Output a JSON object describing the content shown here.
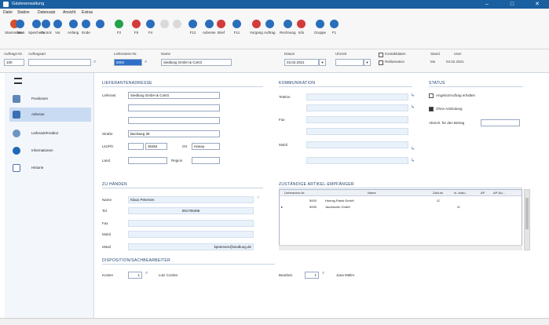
{
  "window": {
    "title": "Gästeverwaltung",
    "controls": [
      "–",
      "□",
      "✕"
    ]
  },
  "menu": [
    "Datei",
    "Station",
    "Datensatz",
    "Ansicht",
    "Extras"
  ],
  "toolbar": {
    "buttons": [
      {
        "label": "Stammdaten",
        "color": "#d84f2a"
      },
      {
        "label": "Neu",
        "color": "#2a6ebb"
      },
      {
        "label": "Speichern",
        "color": "#2a6ebb"
      },
      {
        "label": "Zurück",
        "color": "#2a6ebb"
      },
      {
        "label": "Vor",
        "color": "#2a6ebb"
      },
      {
        "label": "Anfang",
        "color": "#2a6ebb"
      },
      {
        "label": "Ende",
        "color": "#2a6ebb"
      },
      {
        "label": "",
        "color": "#2a6ebb"
      },
      {
        "label": "F2",
        "color": "#22a34a"
      },
      {
        "label": "F5",
        "color": "#d33b3b"
      },
      {
        "label": "F4",
        "color": "#2a6ebb"
      },
      {
        "label": "",
        "color": "#d9d9d9"
      },
      {
        "label": "",
        "color": "#d9d9d9"
      },
      {
        "label": "F12",
        "color": "#2a6ebb"
      },
      {
        "label": "Adresse",
        "color": "#2a6ebb"
      },
      {
        "label": "Brief",
        "color": "#d33b3b"
      },
      {
        "label": "F11",
        "color": "#2a6ebb"
      },
      {
        "label": "Vorgang",
        "color": "#d33b3b"
      },
      {
        "label": "Auftrag",
        "color": "#2a6ebb"
      },
      {
        "label": "Rechnung",
        "color": "#2a6ebb"
      },
      {
        "label": "Info",
        "color": "#d33b3b"
      },
      {
        "label": "Gruppe",
        "color": "#2a6ebb"
      },
      {
        "label": "F1",
        "color": "#2a6ebb"
      }
    ]
  },
  "filter": {
    "auftrag_label": "Auftrags-Nr.",
    "auftrag_value": "100",
    "auftragsart_label": "Auftragsart",
    "auftragsart_value": "",
    "lieferanten_label": "Lieferanten-Nr.",
    "lieferanten_value": "5000",
    "name_label": "Name",
    "name_value": "Siedlung GmbH & CoKG",
    "datum_label": "Datum",
    "datum_value": "03.02.2021",
    "uhrzeit_label": "Uhrzeit",
    "uhrzeit_value": "",
    "check1": "Kontaktdaten",
    "check2": "Reklamation",
    "stand_label": "Stand",
    "stand_value": "Mo",
    "user_label": "User",
    "datum2_value": "04.02.2021"
  },
  "sidebar": {
    "items": [
      {
        "label": "Positionen",
        "color": "#4a76ad"
      },
      {
        "label": "Adresse",
        "color": "#4a76ad"
      },
      {
        "label": "Lieferant/Kreditor",
        "color": "#4a76ad"
      },
      {
        "label": "Informationen",
        "color": "#2a6ebb"
      },
      {
        "label": "Historie",
        "color": "#4a76ad"
      }
    ]
  },
  "lieferantenadresse": {
    "heading": "LIEFERANTENADRESSE",
    "lieferant_label": "Lieferant",
    "lieferant_value": "Siedlung GmbH & CoKG",
    "line2": "",
    "line3": "",
    "strasse_label": "Straße",
    "strasse_value": "Backweg 38",
    "plz_label": "Lkz/Plz",
    "lkz_value": "",
    "plz_value": "36364",
    "ort_label": "Ort",
    "ort_value": "Hanau",
    "land_label": "Land",
    "land_value": "",
    "region_label": "Region",
    "region_value": ""
  },
  "kommunikation": {
    "heading": "KOMMUNIKATION",
    "telefon_label": "Telefon",
    "fax_label": "Fax",
    "mobil_label": "Mobil",
    "telefon": "",
    "fax": "",
    "mobil": ""
  },
  "status": {
    "heading": "STATUS",
    "angebot_label": "Angebot/Auftrag erhalten",
    "ohne_label": "Ohne Anbindung",
    "abrech_label": "Abrech. für den Betrag",
    "abrech_value": ""
  },
  "zu_haenden": {
    "heading": "ZU HÄNDEN",
    "name_label": "Name",
    "name_value": "Klaus Petersen",
    "tel_label": "Tel.",
    "tel_value": "091705496",
    "fax_label": "Fax",
    "fax_value": "",
    "mobil_label": "Mobil",
    "mobil_value": "",
    "email_label": "eMail",
    "email_value": "kpetersen@siedlung.de"
  },
  "zustaendige": {
    "heading": "ZUSTÄNDIGE ARTIKEL-EMPFÄNGER",
    "columns": [
      "Lieferanten-Nr.",
      "Name",
      "Zahl.ke",
      "in. Anbu.",
      "AP",
      "AP-Nu..."
    ],
    "rows": [
      {
        "nr": "5003",
        "name": "Hoenig Pabst GmbH",
        "z": "",
        "a": ""
      },
      {
        "nr": "5005",
        "name": "Jacobsohn GmbH",
        "z": "",
        "a": ""
      }
    ]
  },
  "disposition": {
    "heading": "DISPOSITION/SACHBEARBEITER",
    "kosten_label": "Kosten",
    "kosten_value": "1",
    "kosten_name": "Lutz Cordes",
    "bearb_label": "Bearbeit.",
    "bearb_value": "1",
    "bearb_name": "Jana Müller"
  }
}
